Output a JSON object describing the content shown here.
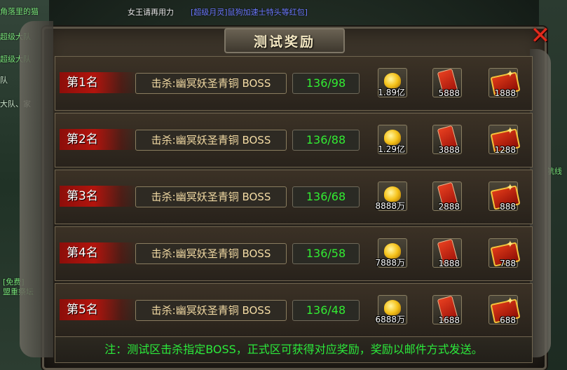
{
  "scene": {
    "texts": [
      "角落里的猫",
      "女王请再用力",
      "[超级月灵]鼠狗加速士特头等红包]",
      "超级大队",
      "超级大队",
      "队",
      "大队、家",
      "航线",
      "[免费]",
      "盟重祭坛"
    ]
  },
  "dialog": {
    "title": "测试奖励",
    "close_label": "✕",
    "rows": [
      {
        "rank": "第1名",
        "task": "击杀:幽冥妖圣青铜 BOSS",
        "progress": "136/98",
        "rewards": {
          "gold": "1.89亿",
          "redbag": "5888",
          "envelope": "1888"
        }
      },
      {
        "rank": "第2名",
        "task": "击杀:幽冥妖圣青铜 BOSS",
        "progress": "136/88",
        "rewards": {
          "gold": "1.29亿",
          "redbag": "3888",
          "envelope": "1288"
        }
      },
      {
        "rank": "第3名",
        "task": "击杀:幽冥妖圣青铜 BOSS",
        "progress": "136/68",
        "rewards": {
          "gold": "8888万",
          "redbag": "2888",
          "envelope": "888"
        }
      },
      {
        "rank": "第4名",
        "task": "击杀:幽冥妖圣青铜 BOSS",
        "progress": "136/58",
        "rewards": {
          "gold": "7888万",
          "redbag": "1888",
          "envelope": "788"
        }
      },
      {
        "rank": "第5名",
        "task": "击杀:幽冥妖圣青铜 BOSS",
        "progress": "136/48",
        "rewards": {
          "gold": "6888万",
          "redbag": "1688",
          "envelope": "688"
        }
      }
    ],
    "note": "注：测试区击杀指定BOSS，正式区可获得对应奖励，奖励以邮件方式发送。"
  },
  "icons": {
    "gold": "gold-ingot-icon",
    "redbag": "red-packet-icon",
    "envelope": "red-envelope-icon",
    "close": "close-icon"
  },
  "colors": {
    "progress_text": "#32ec32",
    "note_text": "#2bea3b",
    "rank_ribbon": "#b2140d"
  }
}
